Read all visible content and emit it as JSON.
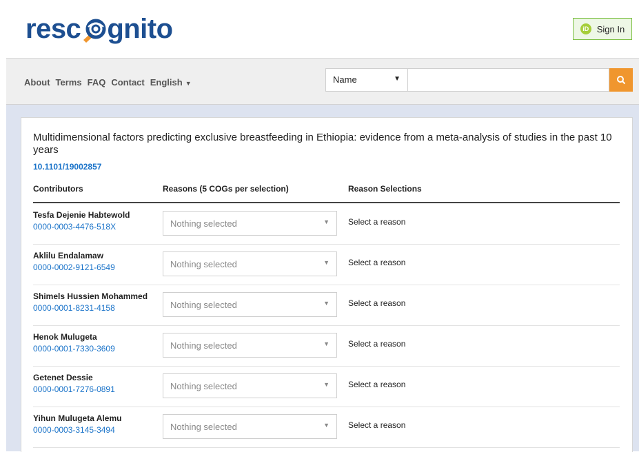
{
  "header": {
    "logo_text_left": "resc",
    "logo_text_right": "gnito",
    "signin_label": "Sign In",
    "orcid_badge": "iD"
  },
  "nav": {
    "links": [
      "About",
      "Terms",
      "FAQ",
      "Contact",
      "English"
    ],
    "search_type": "Name",
    "search_value": ""
  },
  "paper": {
    "title": "Multidimensional factors predicting exclusive breastfeeding in Ethiopia: evidence from a meta-analysis of studies in the past 10 years",
    "doi": "10.1101/19002857"
  },
  "table": {
    "headers": [
      "Contributors",
      "Reasons (5 COGs per selection)",
      "Reason Selections"
    ],
    "rows": [
      {
        "name": "Tesfa Dejenie Habtewold",
        "orcid": "0000-0003-4476-518X",
        "reason": "Nothing selected",
        "selection": "Select a reason"
      },
      {
        "name": "Aklilu Endalamaw",
        "orcid": "0000-0002-9121-6549",
        "reason": "Nothing selected",
        "selection": "Select a reason"
      },
      {
        "name": "Shimels Hussien Mohammed",
        "orcid": "0000-0001-8231-4158",
        "reason": "Nothing selected",
        "selection": "Select a reason"
      },
      {
        "name": "Henok Mulugeta",
        "orcid": "0000-0001-7330-3609",
        "reason": "Nothing selected",
        "selection": "Select a reason"
      },
      {
        "name": "Getenet Dessie",
        "orcid": "0000-0001-7276-0891",
        "reason": "Nothing selected",
        "selection": "Select a reason"
      },
      {
        "name": "Yihun Mulugeta Alemu",
        "orcid": "0000-0003-3145-3494",
        "reason": "Nothing selected",
        "selection": "Select a reason"
      }
    ]
  },
  "colors": {
    "brand_blue": "#1d4f91",
    "link_blue": "#1a73c9",
    "accent_orange": "#f0962e",
    "orcid_green": "#a6ce39",
    "content_background": "#dde3f0"
  },
  "icons": {
    "logo_mark": "magnifier-mark-icon",
    "search_button": "search-icon",
    "dropdown": "caret-down-icon",
    "signin": "orcid-icon"
  }
}
